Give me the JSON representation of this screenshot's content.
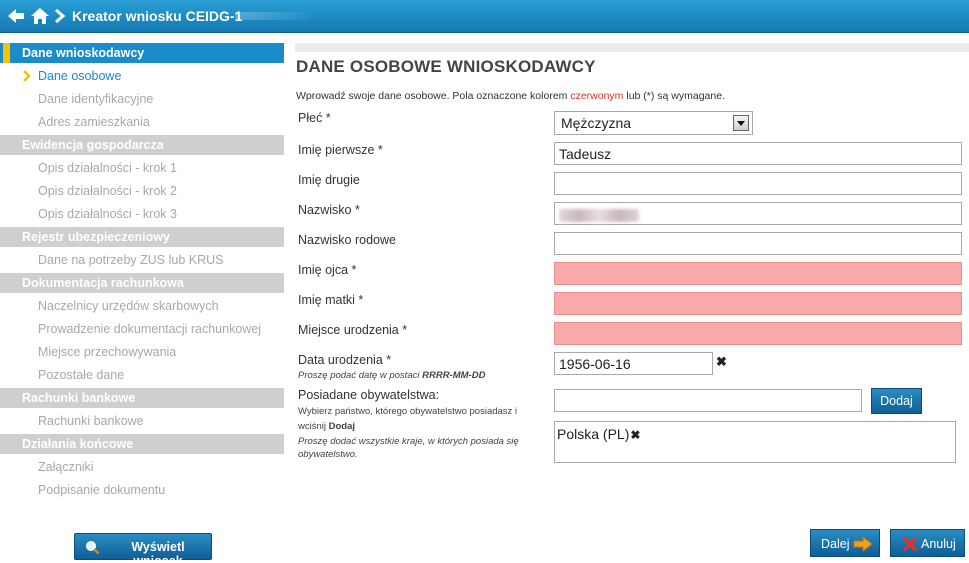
{
  "header": {
    "title": "Kreator wniosku CEIDG-1"
  },
  "sidebar": {
    "sections": [
      {
        "title": "Dane wnioskodawcy",
        "items": [
          "Dane osobowe",
          "Dane identyfikacyjne",
          "Adres zamieszkania"
        ]
      },
      {
        "title": "Ewidencja gospodarcza",
        "items": [
          "Opis działalności - krok 1",
          "Opis działalności - krok 2",
          "Opis działalności - krok 3"
        ]
      },
      {
        "title": "Rejestr ubezpieczeniowy",
        "items": [
          "Dane na potrzeby ZUS lub KRUS"
        ]
      },
      {
        "title": "Dokumentacja rachunkowa",
        "items": [
          "Naczelnicy urzędów skarbowych",
          "Prowadzenie dokumentacji rachunkowej",
          "Miejsce przechowywania",
          "Pozostałe dane"
        ]
      },
      {
        "title": "Rachunki bankowe",
        "items": [
          "Rachunki bankowe"
        ]
      },
      {
        "title": "Działania końcowe",
        "items": [
          "Załączniki",
          "Podpisanie dokumentu"
        ]
      }
    ],
    "preview_button": "Wyświetl wniosek"
  },
  "main": {
    "title": "DANE OSOBOWE WNIOSKODAWCY",
    "intro_pre": "Wprowadź swoje dane osobowe. Pola oznaczone kolorem ",
    "intro_red": "czerwonym",
    "intro_post": " lub (*) są wymagane.",
    "fields": {
      "sex": {
        "label": "Płeć *",
        "value": "Mężczyzna"
      },
      "first_name": {
        "label": "Imię pierwsze *",
        "value": "Tadeusz"
      },
      "second_name": {
        "label": "Imię drugie",
        "value": ""
      },
      "surname": {
        "label": "Nazwisko *"
      },
      "family_name": {
        "label": "Nazwisko rodowe",
        "value": ""
      },
      "father_name": {
        "label": "Imię ojca *",
        "value": ""
      },
      "mother_name": {
        "label": "Imię matki *",
        "value": ""
      },
      "birth_place": {
        "label": "Miejsce urodzenia *",
        "value": ""
      },
      "birth_date": {
        "label": "Data urodzenia *",
        "value": "1956-06-16",
        "hint_pre": "Proszę podać datę w postaci ",
        "hint_format": "RRRR-MM-DD"
      },
      "citizenship": {
        "label": "Posiadane obywatelstwa:",
        "note_pre": "Wybierz państwo, którego obywatelstwo posiadasz i",
        "note_mid": "wciśnij ",
        "note_btn": "Dodaj",
        "hint": "Proszę dodać wszystkie kraje, w których posiada się obywatelstwo.",
        "add_button": "Dodaj",
        "selected": "Polska (PL)"
      }
    },
    "next_button": "Dalej",
    "cancel_button": "Anuluj"
  }
}
